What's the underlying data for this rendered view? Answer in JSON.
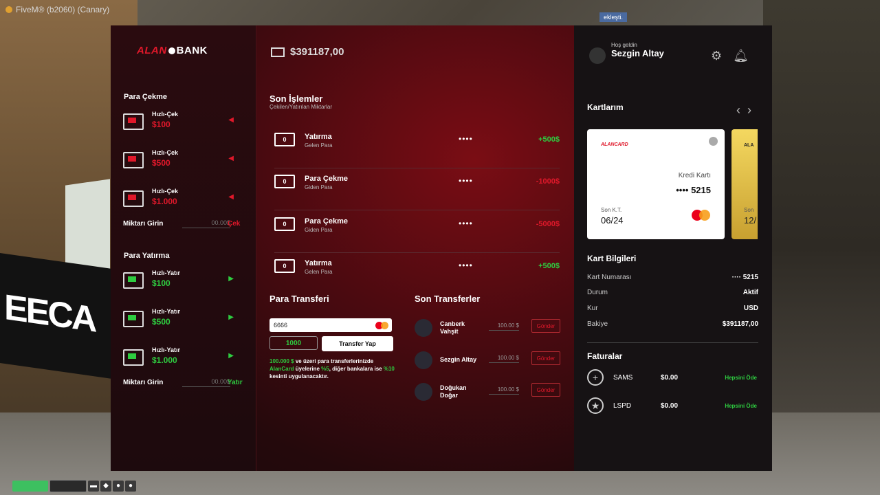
{
  "window": {
    "title": "FiveM® (b2060) (Canary)",
    "notification": "ekleşti."
  },
  "brand": {
    "name_red": "ALAN",
    "name_white": "BANK",
    "accent": "#e0182a",
    "positive": "#2ecc40"
  },
  "header": {
    "balance": "$391187,00",
    "welcome_small": "Hoş geldin",
    "user_name": "Sezgin Altay",
    "settings_icon": "gear-icon",
    "notification_icon": "bell-icon"
  },
  "withdraw": {
    "title": "Para Çekme",
    "quick": [
      {
        "label": "Hızlı-Çek",
        "amount": "$100"
      },
      {
        "label": "Hızlı-Çek",
        "amount": "$500"
      },
      {
        "label": "Hızlı-Çek",
        "amount": "$1.000"
      }
    ],
    "amount_label": "Miktarı Girin",
    "amount_placeholder": "00.00$",
    "action": "Çek"
  },
  "deposit": {
    "title": "Para Yatırma",
    "quick": [
      {
        "label": "Hızlı-Yatır",
        "amount": "$100"
      },
      {
        "label": "Hızlı-Yatır",
        "amount": "$500"
      },
      {
        "label": "Hızlı-Yatır",
        "amount": "$1.000"
      }
    ],
    "amount_label": "Miktarı Girin",
    "amount_placeholder": "00.00$",
    "action": "Yatır"
  },
  "transactions": {
    "title": "Son İşlemler",
    "subtitle": "Çekilen/Yatırılan Miktarlar",
    "items": [
      {
        "name": "Yatırma",
        "sub": "Gelen Para",
        "dots": "••••",
        "value": "+500$",
        "kind": "in"
      },
      {
        "name": "Para Çekme",
        "sub": "Giden Para",
        "dots": "••••",
        "value": "-1000$",
        "kind": "out"
      },
      {
        "name": "Para Çekme",
        "sub": "Giden Para",
        "dots": "••••",
        "value": "-5000$",
        "kind": "out"
      },
      {
        "name": "Yatırma",
        "sub": "Gelen Para",
        "dots": "••••",
        "value": "+500$",
        "kind": "in"
      }
    ]
  },
  "transfer": {
    "title": "Para Transferi",
    "card_value": "6666",
    "amount_value": "1000",
    "button": "Transfer Yap",
    "note_p1": "100.000 $",
    "note_p2": " ve üzeri para transferlerinizde ",
    "note_p3": "AlanCard",
    "note_p4": " üyelerine ",
    "note_p5": "%5",
    "note_p6": ", diğer bankalara ise ",
    "note_p7": "%10",
    "note_p8": " kesinti uygulanacaktır."
  },
  "recent_transfers": {
    "title": "Son Transferler",
    "items": [
      {
        "name": "Canberk Vahşit",
        "amount": "100.00 $",
        "button": "Gönder"
      },
      {
        "name": "Sezgin Altay",
        "amount": "100.00 $",
        "button": "Gönder"
      },
      {
        "name": "Doğukan Doğar",
        "amount": "100.00 $",
        "button": "Gönder"
      }
    ]
  },
  "cards": {
    "title": "Kartlarım",
    "main": {
      "brand": "ALANCARD",
      "type": "Kredi Kartı",
      "number": "•••• 5215",
      "expiry_label": "Son K.T.",
      "expiry": "06/24"
    },
    "second": {
      "brand": "ALA",
      "expiry_label": "Son",
      "expiry": "12/"
    }
  },
  "card_info": {
    "title": "Kart Bilgileri",
    "rows": [
      {
        "k": "Kart Numarası",
        "v": "···· 5215"
      },
      {
        "k": "Durum",
        "v": "Aktif"
      },
      {
        "k": "Kur",
        "v": "USD"
      },
      {
        "k": "Bakiye",
        "v": "$391187,00"
      }
    ]
  },
  "bills": {
    "title": "Faturalar",
    "items": [
      {
        "name": "SAMS",
        "amount": "$0.00",
        "action": "Hepsini Öde",
        "icon": "medical-cross-icon"
      },
      {
        "name": "LSPD",
        "amount": "$0.00",
        "action": "Hepsini Öde",
        "icon": "police-badge-icon"
      }
    ]
  },
  "hud": {
    "health": 1.0,
    "armor": 0.0
  }
}
